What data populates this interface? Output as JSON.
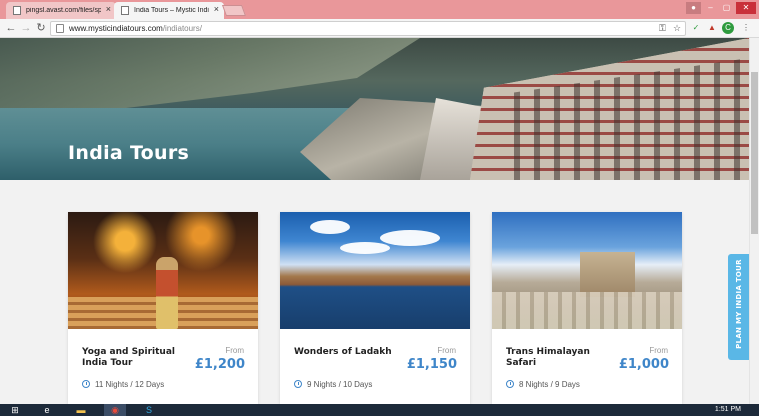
{
  "browser": {
    "tabs": [
      {
        "title": "pingsl.avast.com/files/sp",
        "close": "×"
      },
      {
        "title": "India Tours – Mystic Indi",
        "close": "×"
      }
    ],
    "url_domain": "www.mysticindiatours.com",
    "url_path": "/indiatours/"
  },
  "hero": {
    "title": "India Tours"
  },
  "cards": [
    {
      "name": "Yoga and Spiritual India Tour",
      "from_label": "From",
      "price": "£1,200",
      "duration": "11 Nights / 12 Days"
    },
    {
      "name": "Wonders of Ladakh",
      "from_label": "From",
      "price": "£1,150",
      "duration": "9 Nights / 10 Days"
    },
    {
      "name": "Trans Himalayan Safari",
      "from_label": "From",
      "price": "£1,000",
      "duration": "8 Nights / 9 Days"
    }
  ],
  "plan_tab": {
    "label": "PLAN MY INDIA TOUR"
  },
  "taskbar": {
    "time": "1:51 PM"
  },
  "colors": {
    "price_blue": "#3f86c9",
    "plan_tab_blue": "#5ab7e6",
    "titlebar_red": "#e9979a"
  }
}
